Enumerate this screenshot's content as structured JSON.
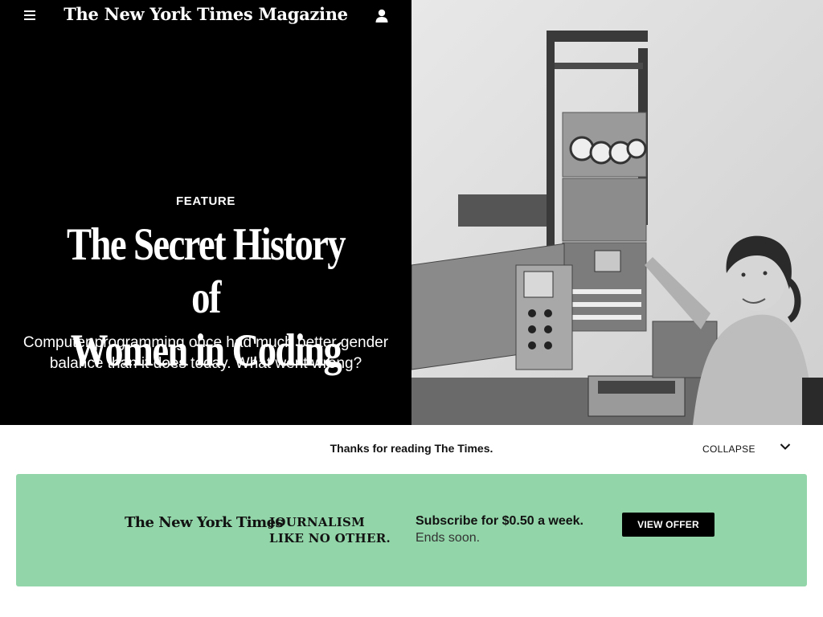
{
  "header": {
    "masthead": "The New York Times Magazine",
    "menu_icon": "hamburger-menu-icon",
    "user_icon": "user-account-icon"
  },
  "article": {
    "kicker": "FEATURE",
    "headline_line1": "The Secret History of",
    "headline_line2": "Women in Coding",
    "dek": "Computer programming once had much better gender balance than it does today. What went wrong?"
  },
  "drawer": {
    "thanks": "Thanks for reading The Times.",
    "collapse_label": "COLLAPSE",
    "collapse_icon": "chevron-down-icon"
  },
  "offer": {
    "logo": "The New York Times",
    "tagline_line1": "JOURNALISM",
    "tagline_line2": "LIKE NO OTHER.",
    "title": "Subscribe for $0.50 a week.",
    "subtitle": "Ends soon.",
    "button_label": "VIEW OFFER",
    "background_color": "#91d5a8"
  }
}
